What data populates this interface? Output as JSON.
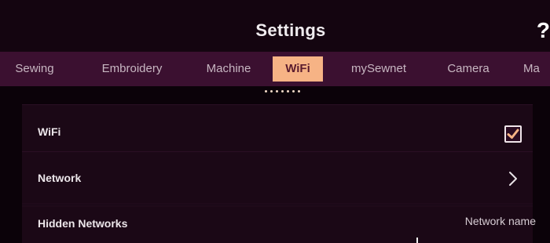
{
  "header": {
    "title": "Settings",
    "help_label": "?"
  },
  "tabs": [
    {
      "label": "Sewing",
      "active": false
    },
    {
      "label": "Embroidery",
      "active": false
    },
    {
      "label": "Machine",
      "active": false
    },
    {
      "label": "WiFi",
      "active": true
    },
    {
      "label": "mySewnet",
      "active": false
    },
    {
      "label": "Camera",
      "active": false
    },
    {
      "label": "Ma",
      "active": false
    }
  ],
  "pagination": {
    "dot_count": 7
  },
  "rows": {
    "wifi": {
      "label": "WiFi",
      "checked": true
    },
    "network": {
      "label": "Network"
    },
    "hidden_networks": {
      "label": "Hidden Networks",
      "network_name_label": "Network name"
    }
  },
  "colors": {
    "accent": "#f6b385",
    "checkmark": "#f6b385",
    "tab_bar": "#3b1030",
    "background": "#0b0209"
  }
}
